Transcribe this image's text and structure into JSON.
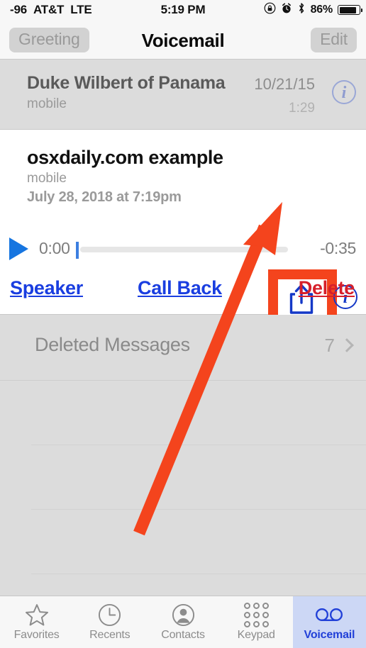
{
  "status_bar": {
    "signal": "-96",
    "carrier": "AT&T",
    "network": "LTE",
    "time": "5:19 PM",
    "battery_percent": "86%",
    "icons": [
      "rotation-lock-icon",
      "alarm-clock-icon",
      "bluetooth-icon",
      "battery-icon"
    ]
  },
  "nav_bar": {
    "left_button": "Greeting",
    "title": "Voicemail",
    "right_button": "Edit"
  },
  "voicemails": [
    {
      "name": "Duke Wilbert of Panama",
      "label": "mobile",
      "date": "10/21/15",
      "duration": "1:29",
      "expanded": false
    },
    {
      "name": "osxdaily.com example",
      "label": "mobile",
      "timestamp": "July 28, 2018 at 7:19pm",
      "expanded": true,
      "player": {
        "elapsed": "0:00",
        "remaining": "-0:35",
        "progress_percent": 0
      },
      "actions": {
        "speaker": "Speaker",
        "call_back": "Call Back",
        "delete": "Delete"
      }
    }
  ],
  "deleted_messages": {
    "label": "Deleted Messages",
    "count": "7"
  },
  "tabs": [
    {
      "label": "Favorites",
      "icon": "star-icon",
      "active": false
    },
    {
      "label": "Recents",
      "icon": "clock-icon",
      "active": false
    },
    {
      "label": "Contacts",
      "icon": "person-icon",
      "active": false
    },
    {
      "label": "Keypad",
      "icon": "keypad-icon",
      "active": false
    },
    {
      "label": "Voicemail",
      "icon": "tape-reels-icon",
      "active": true
    }
  ],
  "annotation": {
    "highlight_color": "#f4441d",
    "target": "share-button",
    "arrow": "points to share button"
  },
  "colors": {
    "accent_blue": "#1a3ee0",
    "delete_red": "#d61f2a",
    "annotation_orange": "#f4441d",
    "tab_active_bg": "#ccd7f5",
    "list_bg": "#dcdcdc",
    "chrome_bg": "#f7f7f7"
  }
}
